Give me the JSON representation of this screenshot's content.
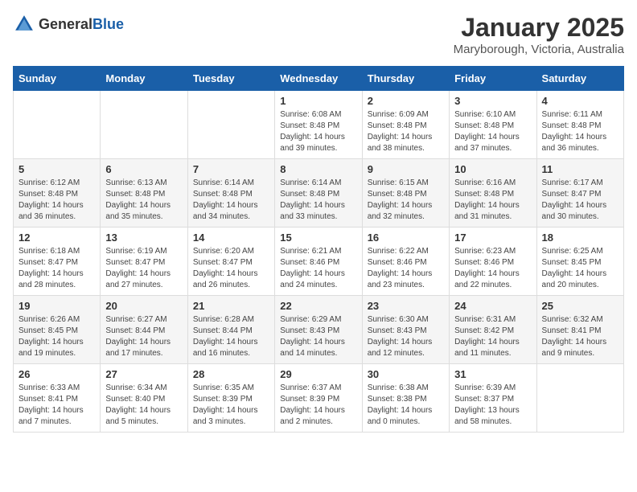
{
  "header": {
    "logo_general": "General",
    "logo_blue": "Blue",
    "month_year": "January 2025",
    "location": "Maryborough, Victoria, Australia"
  },
  "days_of_week": [
    "Sunday",
    "Monday",
    "Tuesday",
    "Wednesday",
    "Thursday",
    "Friday",
    "Saturday"
  ],
  "weeks": [
    [
      {
        "day": "",
        "sunrise": "",
        "sunset": "",
        "daylight": ""
      },
      {
        "day": "",
        "sunrise": "",
        "sunset": "",
        "daylight": ""
      },
      {
        "day": "",
        "sunrise": "",
        "sunset": "",
        "daylight": ""
      },
      {
        "day": "1",
        "sunrise": "Sunrise: 6:08 AM",
        "sunset": "Sunset: 8:48 PM",
        "daylight": "Daylight: 14 hours and 39 minutes."
      },
      {
        "day": "2",
        "sunrise": "Sunrise: 6:09 AM",
        "sunset": "Sunset: 8:48 PM",
        "daylight": "Daylight: 14 hours and 38 minutes."
      },
      {
        "day": "3",
        "sunrise": "Sunrise: 6:10 AM",
        "sunset": "Sunset: 8:48 PM",
        "daylight": "Daylight: 14 hours and 37 minutes."
      },
      {
        "day": "4",
        "sunrise": "Sunrise: 6:11 AM",
        "sunset": "Sunset: 8:48 PM",
        "daylight": "Daylight: 14 hours and 36 minutes."
      }
    ],
    [
      {
        "day": "5",
        "sunrise": "Sunrise: 6:12 AM",
        "sunset": "Sunset: 8:48 PM",
        "daylight": "Daylight: 14 hours and 36 minutes."
      },
      {
        "day": "6",
        "sunrise": "Sunrise: 6:13 AM",
        "sunset": "Sunset: 8:48 PM",
        "daylight": "Daylight: 14 hours and 35 minutes."
      },
      {
        "day": "7",
        "sunrise": "Sunrise: 6:14 AM",
        "sunset": "Sunset: 8:48 PM",
        "daylight": "Daylight: 14 hours and 34 minutes."
      },
      {
        "day": "8",
        "sunrise": "Sunrise: 6:14 AM",
        "sunset": "Sunset: 8:48 PM",
        "daylight": "Daylight: 14 hours and 33 minutes."
      },
      {
        "day": "9",
        "sunrise": "Sunrise: 6:15 AM",
        "sunset": "Sunset: 8:48 PM",
        "daylight": "Daylight: 14 hours and 32 minutes."
      },
      {
        "day": "10",
        "sunrise": "Sunrise: 6:16 AM",
        "sunset": "Sunset: 8:48 PM",
        "daylight": "Daylight: 14 hours and 31 minutes."
      },
      {
        "day": "11",
        "sunrise": "Sunrise: 6:17 AM",
        "sunset": "Sunset: 8:47 PM",
        "daylight": "Daylight: 14 hours and 30 minutes."
      }
    ],
    [
      {
        "day": "12",
        "sunrise": "Sunrise: 6:18 AM",
        "sunset": "Sunset: 8:47 PM",
        "daylight": "Daylight: 14 hours and 28 minutes."
      },
      {
        "day": "13",
        "sunrise": "Sunrise: 6:19 AM",
        "sunset": "Sunset: 8:47 PM",
        "daylight": "Daylight: 14 hours and 27 minutes."
      },
      {
        "day": "14",
        "sunrise": "Sunrise: 6:20 AM",
        "sunset": "Sunset: 8:47 PM",
        "daylight": "Daylight: 14 hours and 26 minutes."
      },
      {
        "day": "15",
        "sunrise": "Sunrise: 6:21 AM",
        "sunset": "Sunset: 8:46 PM",
        "daylight": "Daylight: 14 hours and 24 minutes."
      },
      {
        "day": "16",
        "sunrise": "Sunrise: 6:22 AM",
        "sunset": "Sunset: 8:46 PM",
        "daylight": "Daylight: 14 hours and 23 minutes."
      },
      {
        "day": "17",
        "sunrise": "Sunrise: 6:23 AM",
        "sunset": "Sunset: 8:46 PM",
        "daylight": "Daylight: 14 hours and 22 minutes."
      },
      {
        "day": "18",
        "sunrise": "Sunrise: 6:25 AM",
        "sunset": "Sunset: 8:45 PM",
        "daylight": "Daylight: 14 hours and 20 minutes."
      }
    ],
    [
      {
        "day": "19",
        "sunrise": "Sunrise: 6:26 AM",
        "sunset": "Sunset: 8:45 PM",
        "daylight": "Daylight: 14 hours and 19 minutes."
      },
      {
        "day": "20",
        "sunrise": "Sunrise: 6:27 AM",
        "sunset": "Sunset: 8:44 PM",
        "daylight": "Daylight: 14 hours and 17 minutes."
      },
      {
        "day": "21",
        "sunrise": "Sunrise: 6:28 AM",
        "sunset": "Sunset: 8:44 PM",
        "daylight": "Daylight: 14 hours and 16 minutes."
      },
      {
        "day": "22",
        "sunrise": "Sunrise: 6:29 AM",
        "sunset": "Sunset: 8:43 PM",
        "daylight": "Daylight: 14 hours and 14 minutes."
      },
      {
        "day": "23",
        "sunrise": "Sunrise: 6:30 AM",
        "sunset": "Sunset: 8:43 PM",
        "daylight": "Daylight: 14 hours and 12 minutes."
      },
      {
        "day": "24",
        "sunrise": "Sunrise: 6:31 AM",
        "sunset": "Sunset: 8:42 PM",
        "daylight": "Daylight: 14 hours and 11 minutes."
      },
      {
        "day": "25",
        "sunrise": "Sunrise: 6:32 AM",
        "sunset": "Sunset: 8:41 PM",
        "daylight": "Daylight: 14 hours and 9 minutes."
      }
    ],
    [
      {
        "day": "26",
        "sunrise": "Sunrise: 6:33 AM",
        "sunset": "Sunset: 8:41 PM",
        "daylight": "Daylight: 14 hours and 7 minutes."
      },
      {
        "day": "27",
        "sunrise": "Sunrise: 6:34 AM",
        "sunset": "Sunset: 8:40 PM",
        "daylight": "Daylight: 14 hours and 5 minutes."
      },
      {
        "day": "28",
        "sunrise": "Sunrise: 6:35 AM",
        "sunset": "Sunset: 8:39 PM",
        "daylight": "Daylight: 14 hours and 3 minutes."
      },
      {
        "day": "29",
        "sunrise": "Sunrise: 6:37 AM",
        "sunset": "Sunset: 8:39 PM",
        "daylight": "Daylight: 14 hours and 2 minutes."
      },
      {
        "day": "30",
        "sunrise": "Sunrise: 6:38 AM",
        "sunset": "Sunset: 8:38 PM",
        "daylight": "Daylight: 14 hours and 0 minutes."
      },
      {
        "day": "31",
        "sunrise": "Sunrise: 6:39 AM",
        "sunset": "Sunset: 8:37 PM",
        "daylight": "Daylight: 13 hours and 58 minutes."
      },
      {
        "day": "",
        "sunrise": "",
        "sunset": "",
        "daylight": ""
      }
    ]
  ]
}
